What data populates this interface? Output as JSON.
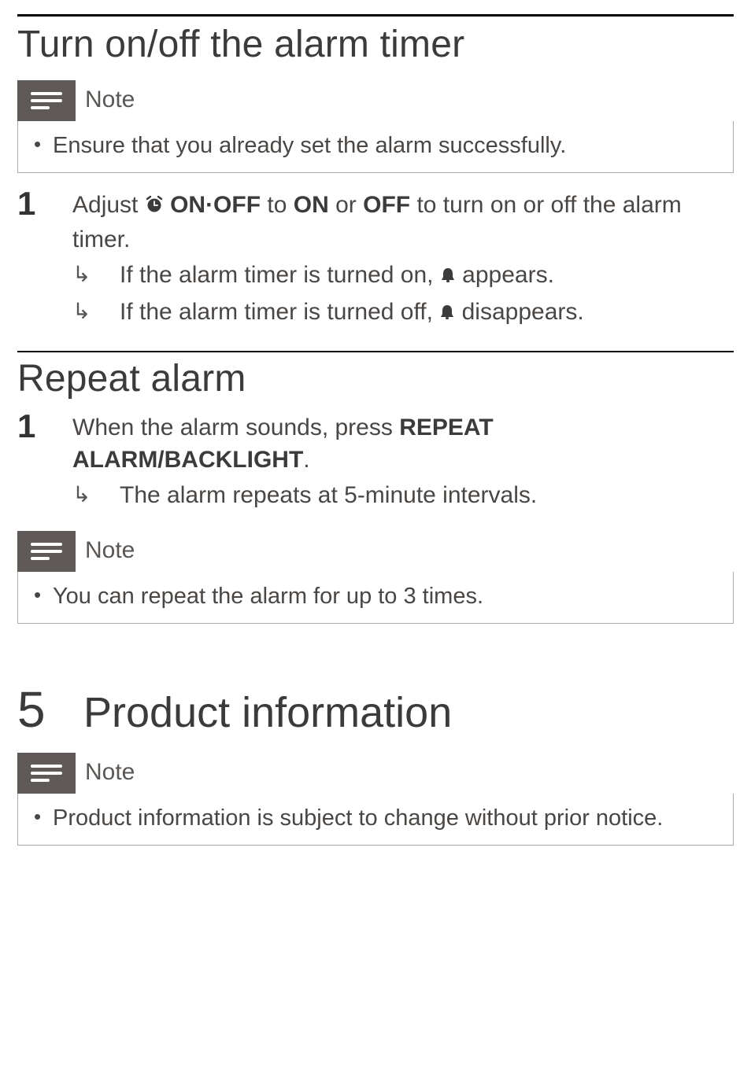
{
  "sections": {
    "alarm_onoff": {
      "heading": "Turn on/off the alarm timer",
      "note": {
        "label": "Note",
        "items": [
          "Ensure that you already set the alarm successfully."
        ]
      },
      "steps": [
        {
          "num": "1",
          "text_prefix": "Adjust ",
          "switch_label": "ON·OFF",
          "text_mid1": " to ",
          "opt_on": "ON",
          "text_mid2": " or ",
          "opt_off": "OFF",
          "text_suffix": " to turn on or off the alarm timer.",
          "results": [
            {
              "prefix": "If the alarm timer is turned on, ",
              "suffix": " appears."
            },
            {
              "prefix": "If the alarm timer is turned off, ",
              "suffix": " disappears."
            }
          ]
        }
      ]
    },
    "repeat": {
      "heading": "Repeat alarm",
      "steps": [
        {
          "num": "1",
          "text_prefix": "When the alarm sounds, press ",
          "button_label": "REPEAT ALARM/BACKLIGHT",
          "text_suffix": ".",
          "results": [
            {
              "text": "The alarm repeats at 5-minute intervals."
            }
          ]
        }
      ],
      "note": {
        "label": "Note",
        "items": [
          "You can repeat the alarm for up to 3 times."
        ]
      }
    },
    "product_info": {
      "chapter_num": "5",
      "title": "Product information",
      "note": {
        "label": "Note",
        "items": [
          "Product information is subject to change without prior notice."
        ]
      }
    }
  }
}
